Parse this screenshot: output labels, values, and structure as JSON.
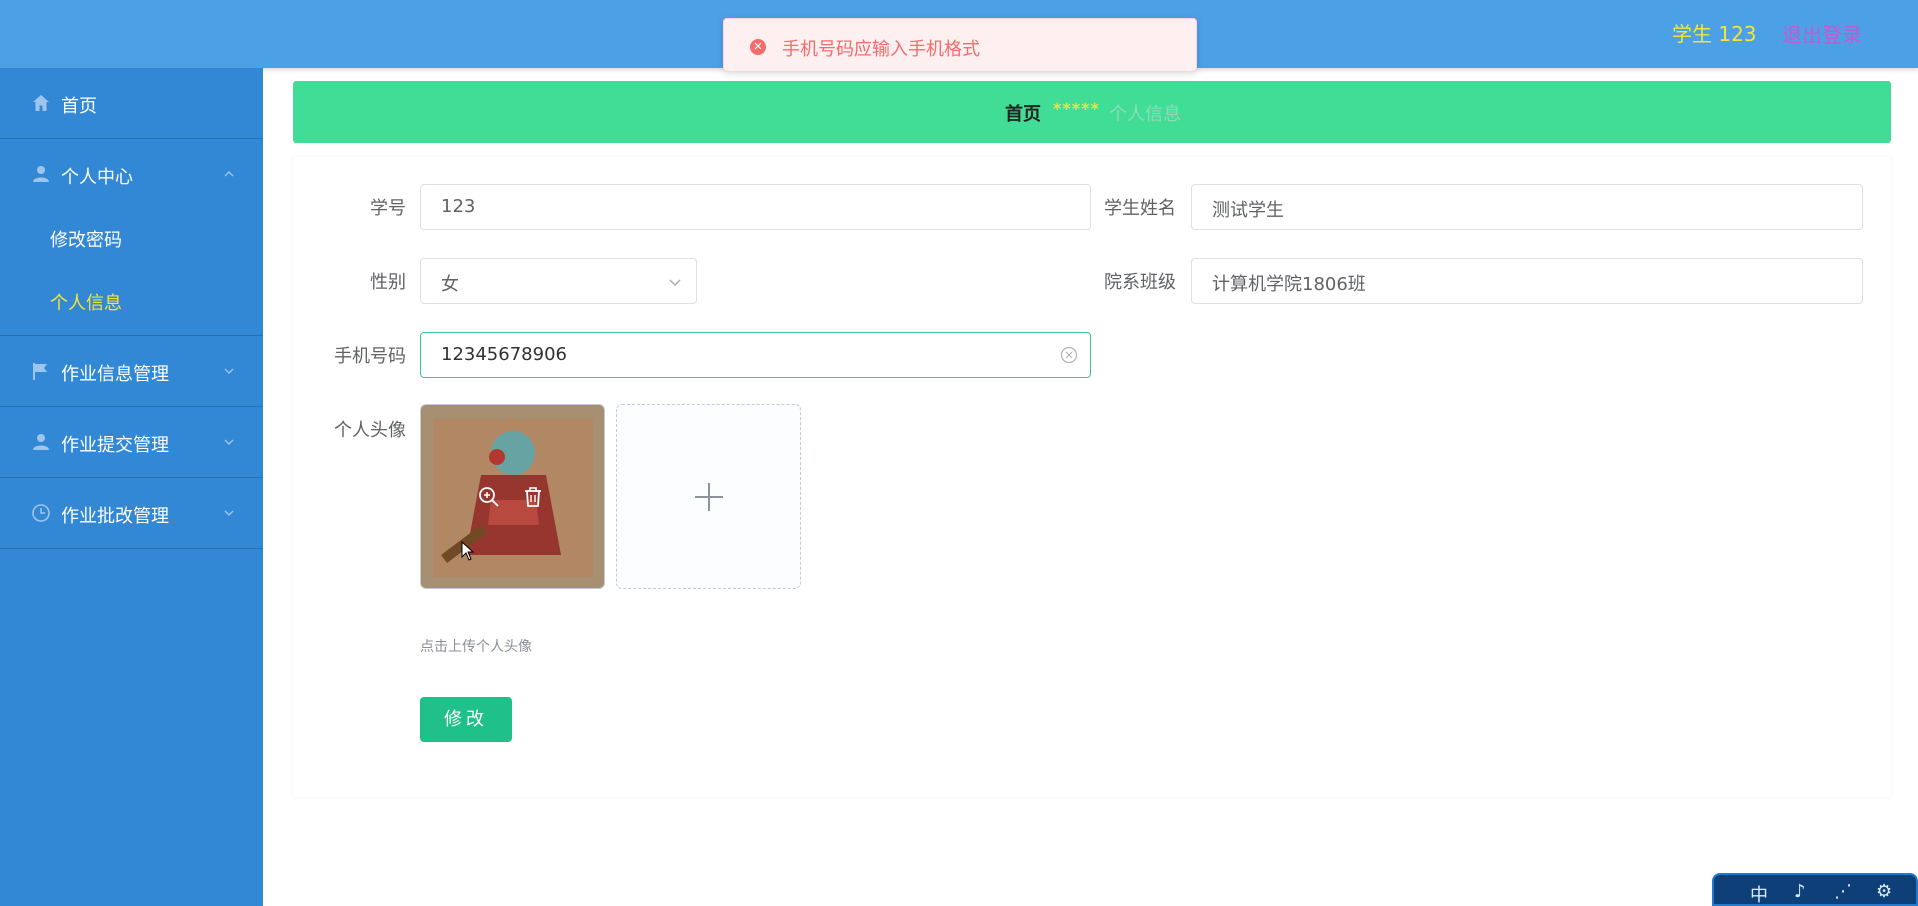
{
  "header": {
    "user_role": "学生 123",
    "logout_label": "退出登录"
  },
  "toast": {
    "message": "手机号码应输入手机格式"
  },
  "sidebar": {
    "items": [
      {
        "label": "首页"
      },
      {
        "label": "个人中心",
        "children": [
          {
            "label": "修改密码"
          },
          {
            "label": "个人信息"
          }
        ]
      },
      {
        "label": "作业信息管理"
      },
      {
        "label": "作业提交管理"
      },
      {
        "label": "作业批改管理"
      }
    ]
  },
  "breadcrumb": {
    "home": "首页",
    "separator": "*****",
    "current": "个人信息"
  },
  "form": {
    "student_id_label": "学号",
    "student_id_value": "123",
    "student_name_label": "学生姓名",
    "student_name_value": "测试学生",
    "gender_label": "性别",
    "gender_value": "女",
    "class_label": "院系班级",
    "class_value": "计算机学院1806班",
    "phone_label": "手机号码",
    "phone_value": "12345678906",
    "avatar_label": "个人头像",
    "upload_hint": "点击上传个人头像",
    "submit_label": "修改"
  },
  "floating_widget": {
    "items": [
      "中",
      "♪",
      "⋰",
      "⚙"
    ]
  },
  "colors": {
    "topbar": "#4ca0e6",
    "sidebar": "#3388d6",
    "breadcrumb_bar": "#41dc96",
    "active_menu": "#f3e53a",
    "error": "#f56c6c",
    "primary_button": "#20c08b"
  }
}
